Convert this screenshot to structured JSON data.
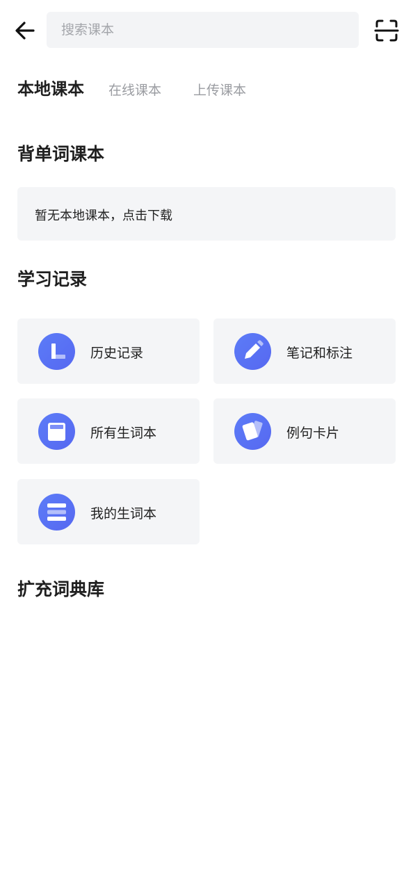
{
  "header": {
    "back_icon": "arrow-left-icon",
    "search_placeholder": "搜索课本",
    "scan_icon": "scan-icon"
  },
  "tabs": [
    {
      "label": "本地课本",
      "active": true
    },
    {
      "label": "在线课本",
      "active": false
    },
    {
      "label": "上传课本",
      "active": false
    }
  ],
  "sections": {
    "wordbook_title": "背单词课本",
    "empty_message": "暂无本地课本，点击下载",
    "records_title": "学习记录",
    "dictionary_title": "扩充词典库"
  },
  "records": [
    {
      "label": "历史记录",
      "icon": "history-icon"
    },
    {
      "label": "笔记和标注",
      "icon": "pencil-icon"
    },
    {
      "label": "所有生词本",
      "icon": "notebook-icon"
    },
    {
      "label": "例句卡片",
      "icon": "cards-icon"
    },
    {
      "label": "我的生词本",
      "icon": "list-icon"
    }
  ],
  "colors": {
    "accent": "#5c6ff5",
    "card_bg": "#f4f5f7",
    "muted_text": "#9a9ca1"
  }
}
